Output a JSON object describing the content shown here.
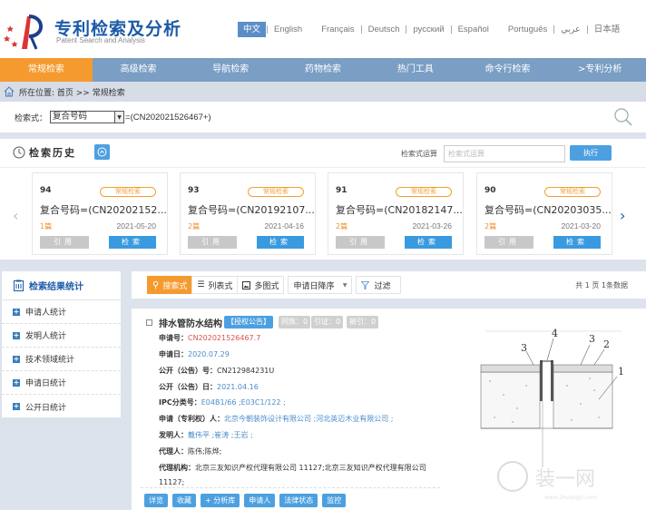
{
  "header": {
    "title": "专利检索及分析",
    "subtitle": "Patent Search and Analysis",
    "languages": [
      "中文",
      "English",
      "Français",
      "Deutsch",
      "русский",
      "Español",
      "Português",
      "عربي",
      "日本語"
    ],
    "active_language": "中文"
  },
  "nav": {
    "items": [
      "常规检索",
      "高级检索",
      "导航检索",
      "药物检索",
      "热门工具",
      "命令行检索",
      ">专利分析"
    ],
    "active": "常规检索"
  },
  "breadcrumb": {
    "label": "所在位置: 首页 >> 常规检索"
  },
  "search": {
    "label": "检索式：",
    "field_select": "复合号码",
    "expression": "=(CN202021526467+)"
  },
  "history": {
    "title": "检索历史",
    "calc_label": "检索式运算",
    "calc_placeholder": "检索式运算",
    "exec_label": "执行",
    "cards": [
      {
        "num": "94",
        "tag": "常规检索",
        "query": "复合号码=(CN20202152...",
        "count": "1篇",
        "date": "2021-05-20",
        "cite": "引用",
        "search": "检索"
      },
      {
        "num": "93",
        "tag": "常规检索",
        "query": "复合号码=(CN20192107...",
        "count": "2篇",
        "date": "2021-04-16",
        "cite": "引用",
        "search": "检索"
      },
      {
        "num": "91",
        "tag": "常规检索",
        "query": "复合号码=(CN20182147...",
        "count": "2篇",
        "date": "2021-03-26",
        "cite": "引用",
        "search": "检索"
      },
      {
        "num": "90",
        "tag": "常规检索",
        "query": "复合号码=(CN20203035...",
        "count": "2篇",
        "date": "2021-03-20",
        "cite": "引用",
        "search": "检索"
      }
    ]
  },
  "stats": {
    "title": "检索结果统计",
    "items": [
      "申请人统计",
      "发明人统计",
      "技术领域统计",
      "申请日统计",
      "公开日统计"
    ]
  },
  "toolbar": {
    "views": [
      "搜索式",
      "列表式",
      "多图式"
    ],
    "active_view": "搜索式",
    "sort": "申请日降序",
    "filter": "过滤",
    "count": "共 1 页 1条数据"
  },
  "result": {
    "title": "排水管防水结构",
    "grant_badge": "【授权公告】",
    "badges": [
      "同族：0",
      "引证：0",
      "被引：0"
    ],
    "fields": {
      "app_no_label": "申请号：",
      "app_no": "CN202021526467.7",
      "app_date_label": "申请日：",
      "app_date": "2020.07.29",
      "pub_no_label": "公开（公告）号：",
      "pub_no": "CN212984231U",
      "pub_date_label": "公开（公告）日：",
      "pub_date": "2021.04.16",
      "ipc_label": "IPC分类号：",
      "ipc": "E04B1/66 ;E03C1/122 ;",
      "applicant_label": "申请（专利权）人：",
      "applicant": "北京今朝装饰设计有限公司 ;河北英迈木业有限公司 ;",
      "inventor_label": "发明人：",
      "inventor": "戴伟平 ;崔涛 ;王岩 ;",
      "agent_label": "代理人：",
      "agent": "陈伟;陈烨;",
      "agency_label": "代理机构：",
      "agency_line1": "北京三友知识产权代理有限公司 11127;北京三友知识产权代理有限公司",
      "agency_line2": "11127;"
    },
    "actions": [
      "详览",
      "收藏",
      "+ 分析库",
      "申请人",
      "法律状态",
      "监控"
    ],
    "drawing_labels": [
      "1",
      "2",
      "3",
      "3",
      "4"
    ]
  },
  "watermark": {
    "text": "装一网",
    "url": "www.zhuangyi.com"
  },
  "colors": {
    "brand_blue": "#1b5aa8",
    "nav_blue": "#7a9ec4",
    "accent_orange": "#f59a2e",
    "button_blue": "#4da0e0",
    "red_link": "#d9534f"
  }
}
